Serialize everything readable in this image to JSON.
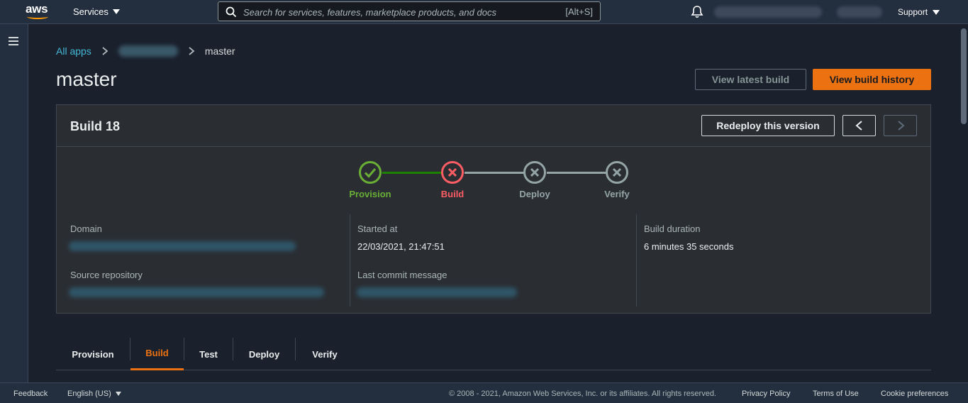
{
  "topnav": {
    "logo_text": "aws",
    "services_label": "Services",
    "search_placeholder": "Search for services, features, marketplace products, and docs",
    "search_shortcut": "[Alt+S]",
    "support_label": "Support"
  },
  "breadcrumb": {
    "all_apps": "All apps",
    "current": "master"
  },
  "page": {
    "title": "master",
    "view_latest_build": "View latest build",
    "view_build_history": "View build history"
  },
  "build": {
    "title": "Build 18",
    "redeploy_label": "Redeploy this version",
    "steps": [
      {
        "label": "Provision",
        "status": "success",
        "color": "#6aaf35"
      },
      {
        "label": "Build",
        "status": "failed",
        "color": "#ff5d64"
      },
      {
        "label": "Deploy",
        "status": "skipped",
        "color": "#95a5a6"
      },
      {
        "label": "Verify",
        "status": "skipped",
        "color": "#95a5a6"
      }
    ],
    "details": {
      "domain_label": "Domain",
      "source_repository_label": "Source repository",
      "started_at_label": "Started at",
      "started_at_value": "22/03/2021, 21:47:51",
      "last_commit_message_label": "Last commit message",
      "build_duration_label": "Build duration",
      "build_duration_value": "6 minutes 35 seconds"
    }
  },
  "tabs": [
    {
      "label": "Provision",
      "active": false
    },
    {
      "label": "Build",
      "active": true
    },
    {
      "label": "Test",
      "active": false
    },
    {
      "label": "Deploy",
      "active": false
    },
    {
      "label": "Verify",
      "active": false
    }
  ],
  "footer": {
    "feedback": "Feedback",
    "language": "English (US)",
    "copyright": "© 2008 - 2021, Amazon Web Services, Inc. or its affiliates. All rights reserved.",
    "privacy_policy": "Privacy Policy",
    "terms_of_use": "Terms of Use",
    "cookie_preferences": "Cookie preferences"
  },
  "colors": {
    "accent": "#ec7211",
    "link": "#44b9d6",
    "success": "#6aaf35",
    "error": "#ff5d64",
    "neutral": "#95a5a6"
  }
}
